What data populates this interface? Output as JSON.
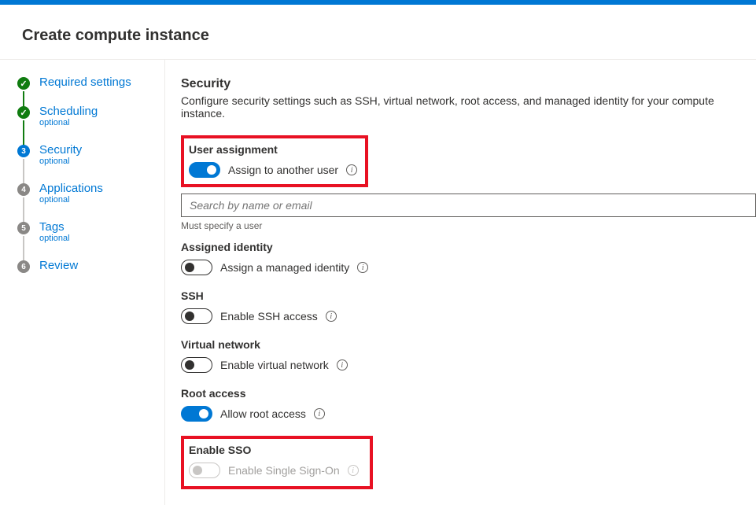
{
  "page": {
    "title": "Create compute instance"
  },
  "steps": [
    {
      "label": "Required settings",
      "sub": null,
      "state": "check"
    },
    {
      "label": "Scheduling",
      "sub": "optional",
      "state": "check"
    },
    {
      "label": "Security",
      "sub": "optional",
      "state": "active",
      "num": "3"
    },
    {
      "label": "Applications",
      "sub": "optional",
      "state": "inactive",
      "num": "4"
    },
    {
      "label": "Tags",
      "sub": "optional",
      "state": "inactive",
      "num": "5"
    },
    {
      "label": "Review",
      "sub": null,
      "state": "inactive",
      "num": "6"
    }
  ],
  "security": {
    "heading": "Security",
    "description": "Configure security settings such as SSH, virtual network, root access, and managed identity for your compute instance."
  },
  "userAssignment": {
    "title": "User assignment",
    "toggleLabel": "Assign to another user",
    "searchPlaceholder": "Search by name or email",
    "helper": "Must specify a user"
  },
  "assignedIdentity": {
    "title": "Assigned identity",
    "toggleLabel": "Assign a managed identity"
  },
  "ssh": {
    "title": "SSH",
    "toggleLabel": "Enable SSH access"
  },
  "vnet": {
    "title": "Virtual network",
    "toggleLabel": "Enable virtual network"
  },
  "root": {
    "title": "Root access",
    "toggleLabel": "Allow root access"
  },
  "sso": {
    "title": "Enable SSO",
    "toggleLabel": "Enable Single Sign-On"
  }
}
